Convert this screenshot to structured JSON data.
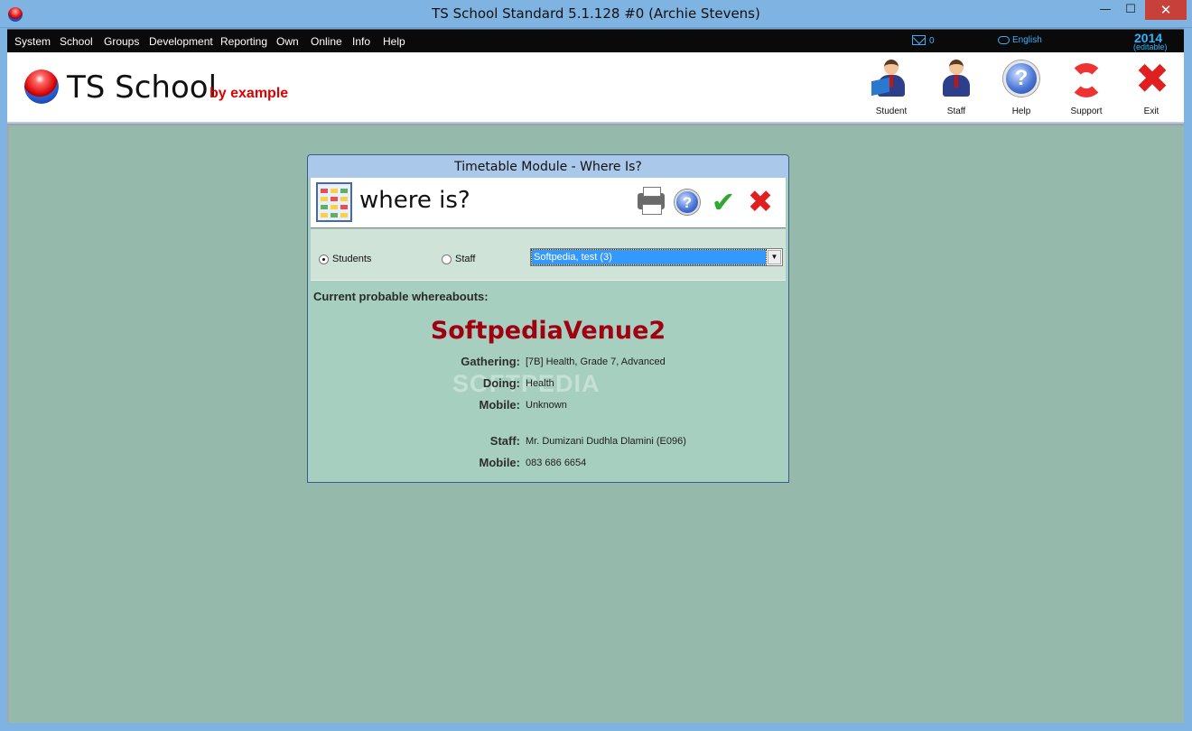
{
  "window": {
    "title": "TS School Standard 5.1.128 #0 (Archie Stevens)",
    "min_glyph": "—",
    "max_glyph": "☐",
    "close_glyph": "✕"
  },
  "menu": {
    "items": [
      "System",
      "School",
      "Groups",
      "Development",
      "Reporting",
      "Own",
      "Online",
      "Info",
      "Help"
    ],
    "mail_count": "0",
    "language": "English",
    "year": "2014",
    "year_note": "(editable)"
  },
  "header": {
    "logo_text": "TS School",
    "logo_sub": "by example",
    "tools": [
      {
        "label": "Student",
        "icon": "student-icon"
      },
      {
        "label": "Staff",
        "icon": "staff-icon"
      },
      {
        "label": "Help",
        "icon": "help-icon"
      },
      {
        "label": "Support",
        "icon": "lifebuoy-icon"
      },
      {
        "label": "Exit",
        "icon": "exit-icon"
      }
    ]
  },
  "dialog": {
    "title": "Timetable Module - Where Is?",
    "heading": "where is?",
    "radio_students": "Students",
    "radio_staff": "Staff",
    "selected_radio": "Students",
    "combo_value": "Softpedia, test (3)",
    "whereabouts_label": "Current probable whereabouts:",
    "venue": "SoftpediaVenue2",
    "watermark": "SOFTPEDIA",
    "details": {
      "gathering_label": "Gathering:",
      "gathering_value": "[7B] Health, Grade 7, Advanced",
      "doing_label": "Doing:",
      "doing_value": "Health",
      "mobile_label": "Mobile:",
      "mobile_value": "Unknown",
      "staff_label": "Staff:",
      "staff_value": "Mr. Dumizani Dudhla Dlamini (E096)",
      "staff_mobile_label": "Mobile:",
      "staff_mobile_value": "083 686 6654"
    }
  },
  "colors": {
    "workspace": "#95b9ab",
    "dialog_body": "#a7cfbf",
    "venue_text": "#a00010",
    "menu_accent": "#3ab0ff"
  }
}
